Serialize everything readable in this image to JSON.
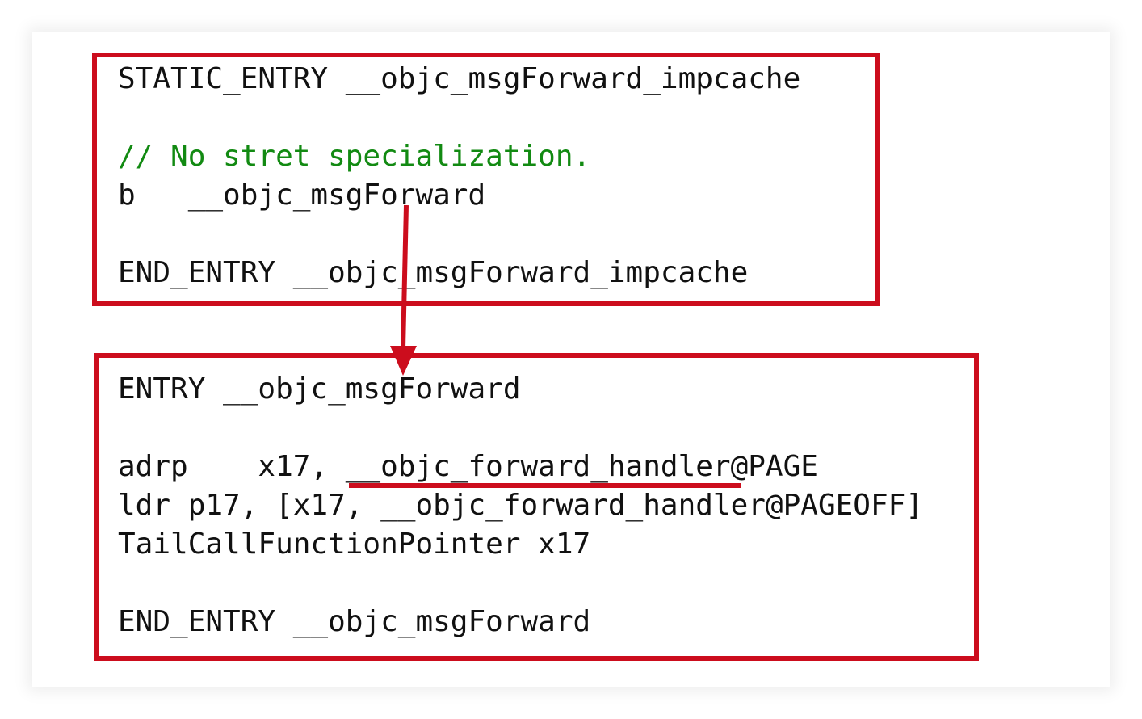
{
  "top_block": {
    "line1": "STATIC_ENTRY __objc_msgForward_impcache",
    "line2": "",
    "line3": "// No stret specialization.",
    "line4": "b   __objc_msgForward",
    "line5": "",
    "line6": "END_ENTRY __objc_msgForward_impcache"
  },
  "bottom_block": {
    "line1": "ENTRY __objc_msgForward",
    "line2": "",
    "line3": "adrp    x17, __objc_forward_handler@PAGE",
    "line4": "ldr p17, [x17, __objc_forward_handler@PAGEOFF]",
    "line5": "TailCallFunctionPointer x17",
    "line6": "",
    "line7": "END_ENTRY __objc_msgForward"
  },
  "colors": {
    "annotation_red": "#cc0d1d",
    "comment_green": "#128a12",
    "code_text": "#111111"
  }
}
